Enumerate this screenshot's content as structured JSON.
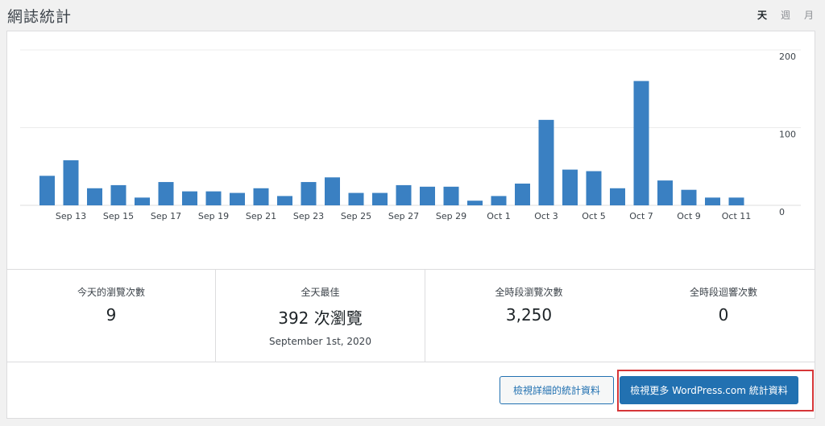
{
  "header": {
    "title": "網誌統計",
    "tabs": [
      {
        "label": "天",
        "active": true
      },
      {
        "label": "週",
        "active": false
      },
      {
        "label": "月",
        "active": false
      }
    ]
  },
  "chart_data": {
    "type": "bar",
    "title": "",
    "xlabel": "",
    "ylabel": "",
    "ylim": [
      0,
      200
    ],
    "y_ticks": [
      0,
      100,
      200
    ],
    "grid": true,
    "color": "#3a80c2",
    "categories": [
      "Sep 12",
      "Sep 13",
      "Sep 14",
      "Sep 15",
      "Sep 16",
      "Sep 17",
      "Sep 18",
      "Sep 19",
      "Sep 20",
      "Sep 21",
      "Sep 22",
      "Sep 23",
      "Sep 24",
      "Sep 25",
      "Sep 26",
      "Sep 27",
      "Sep 28",
      "Sep 29",
      "Sep 30",
      "Oct 1",
      "Oct 2",
      "Oct 3",
      "Oct 4",
      "Oct 5",
      "Oct 6",
      "Oct 7",
      "Oct 8",
      "Oct 9",
      "Oct 10",
      "Oct 11"
    ],
    "tick_labels": [
      "Sep 13",
      "Sep 15",
      "Sep 17",
      "Sep 19",
      "Sep 21",
      "Sep 23",
      "Sep 25",
      "Sep 27",
      "Sep 29",
      "Oct 1",
      "Oct 3",
      "Oct 5",
      "Oct 7",
      "Oct 9",
      "Oct 11"
    ],
    "values": [
      38,
      58,
      22,
      26,
      10,
      30,
      18,
      18,
      16,
      22,
      12,
      30,
      36,
      16,
      16,
      26,
      24,
      24,
      6,
      12,
      28,
      110,
      46,
      44,
      22,
      160,
      32,
      20,
      10,
      10
    ]
  },
  "stats": {
    "today_label": "今天的瀏覽次數",
    "today_value": "9",
    "best_label": "全天最佳",
    "best_value": "392 次瀏覽",
    "best_date": "September 1st, 2020",
    "alltime_views_label": "全時段瀏覽次數",
    "alltime_views_value": "3,250",
    "alltime_comments_label": "全時段迴響次數",
    "alltime_comments_value": "0"
  },
  "actions": {
    "details_label": "檢視詳細的統計資料",
    "more_label": "檢視更多 WordPress.com 統計資料"
  }
}
